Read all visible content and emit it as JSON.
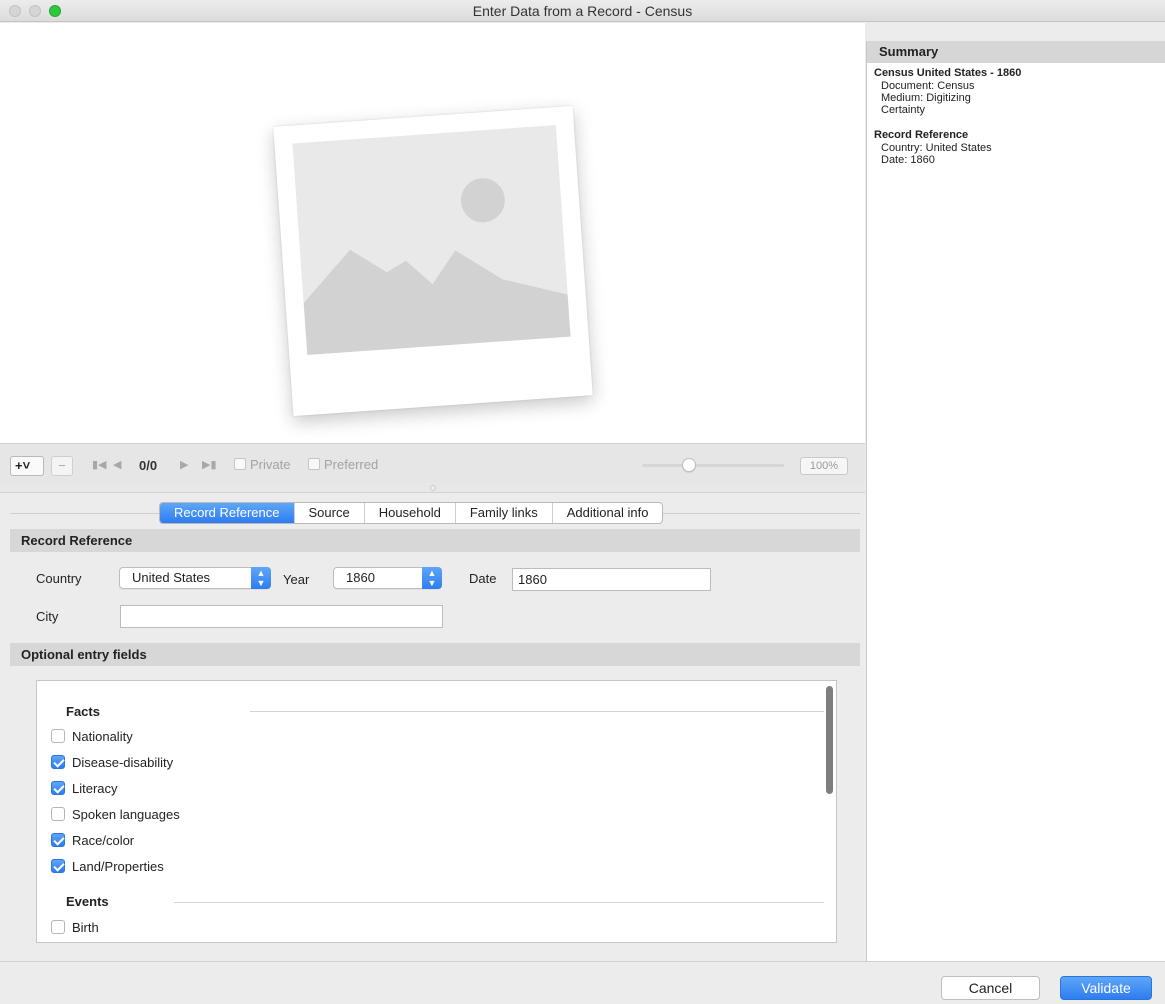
{
  "window": {
    "title": "Enter Data from a Record - Census"
  },
  "media_toolbar": {
    "add_label": "+˅",
    "remove_label": "−",
    "counter": "0/0",
    "private_label": "Private",
    "preferred_label": "Preferred",
    "zoom": "100%",
    "zoom_level_percent": 30
  },
  "tabs": [
    {
      "label": "Record Reference",
      "active": true
    },
    {
      "label": "Source",
      "active": false
    },
    {
      "label": "Household",
      "active": false
    },
    {
      "label": "Family links",
      "active": false
    },
    {
      "label": "Additional info",
      "active": false
    }
  ],
  "record_reference": {
    "section_title": "Record Reference",
    "country_label": "Country",
    "country_value": "United States",
    "year_label": "Year",
    "year_value": "1860",
    "date_label": "Date",
    "date_value": "1860",
    "city_label": "City",
    "city_value": ""
  },
  "optional": {
    "section_title": "Optional entry fields",
    "facts_title": "Facts",
    "facts": [
      {
        "label": "Nationality",
        "checked": false
      },
      {
        "label": "Disease-disability",
        "checked": true
      },
      {
        "label": "Literacy",
        "checked": true
      },
      {
        "label": "Spoken languages",
        "checked": false
      },
      {
        "label": "Race/color",
        "checked": true
      },
      {
        "label": "Land/Properties",
        "checked": true
      }
    ],
    "events_title": "Events",
    "events": [
      {
        "label": "Birth",
        "checked": false
      }
    ]
  },
  "summary": {
    "title": "Summary",
    "source_title": "Census United States - 1860",
    "source_lines": [
      "Document: Census",
      "Medium: Digitizing",
      "Certainty"
    ],
    "ref_title": "Record Reference",
    "ref_lines": [
      "Country: United States",
      "Date: 1860"
    ]
  },
  "buttons": {
    "cancel": "Cancel",
    "validate": "Validate"
  },
  "colors": {
    "accent": "#2e7df0",
    "accent_light": "#5ea6f8"
  }
}
